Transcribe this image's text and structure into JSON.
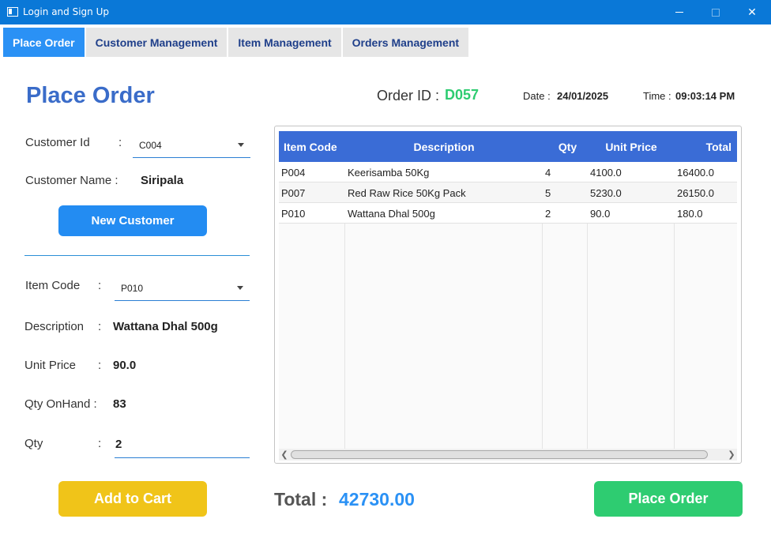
{
  "window": {
    "title": "Login and Sign Up"
  },
  "tabs": [
    {
      "label": "Place Order",
      "active": true
    },
    {
      "label": "Customer Management",
      "active": false
    },
    {
      "label": "Item Management",
      "active": false
    },
    {
      "label": "Orders Management",
      "active": false
    }
  ],
  "page": {
    "title": "Place Order"
  },
  "customer": {
    "id_label": "Customer Id",
    "colon": ":",
    "id_value": "C004",
    "name_label": "Customer Name :",
    "name_value": "Siripala",
    "new_button": "New Customer"
  },
  "item": {
    "code_label": "Item Code",
    "code_value": "P010",
    "description_label": "Description",
    "description_value": "Wattana Dhal 500g",
    "unit_price_label": "Unit Price",
    "unit_price_value": "90.0",
    "qty_onhand_label": "Qty OnHand :",
    "qty_onhand_value": "83",
    "qty_label": "Qty",
    "qty_value": "2",
    "add_button": "Add to Cart"
  },
  "order": {
    "id_label": "Order ID :",
    "id_value": "D057",
    "date_label": "Date :",
    "date_value": "24/01/2025",
    "time_label": "Time :",
    "time_value": "09:03:14 PM"
  },
  "table": {
    "columns": [
      "Item Code",
      "Description",
      "Qty",
      "Unit Price",
      "Total"
    ],
    "rows": [
      [
        "P004",
        "Keerisamba 50Kg",
        "4",
        "4100.0",
        "16400.0"
      ],
      [
        "P007",
        "Red Raw Rice 50Kg Pack",
        "5",
        "5230.0",
        "26150.0"
      ],
      [
        "P010",
        "Wattana Dhal 500g",
        "2",
        "90.0",
        "180.0"
      ]
    ]
  },
  "footer": {
    "total_label": "Total :",
    "total_value": "42730.00",
    "place_order_button": "Place Order"
  },
  "colors": {
    "title_bar": "#0a78d7",
    "tab_active": "#2a91f5",
    "heading": "#3a6cc9",
    "order_id": "#2ecc71",
    "table_header": "#3a6cd6",
    "btn_new_customer": "#238cf2",
    "btn_add_to_cart": "#f0c419",
    "btn_place_order": "#2ecc71",
    "total_value": "#2a91f5"
  },
  "icons": {
    "app": "window-app-icon",
    "minimize": "minimize-icon",
    "maximize": "maximize-icon",
    "close": "close-icon",
    "combo_arrow": "chevron-down-icon",
    "scroll_left": "chevron-left-icon",
    "scroll_right": "chevron-right-icon"
  }
}
